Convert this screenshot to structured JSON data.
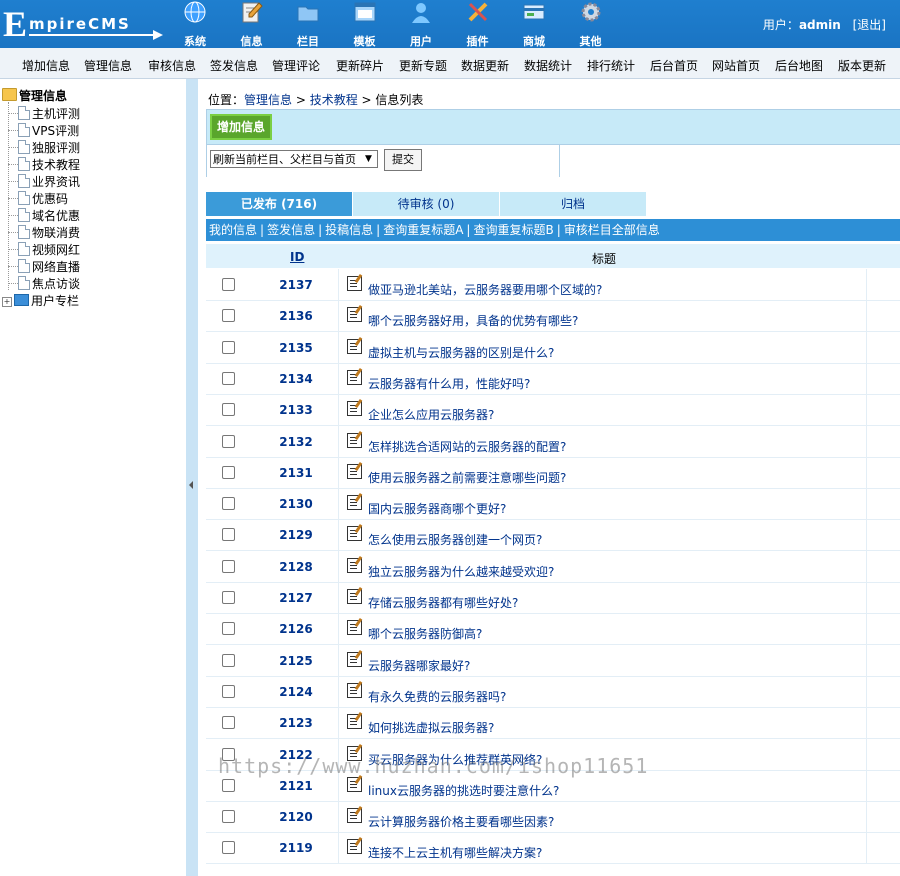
{
  "logo": {
    "initial": "E",
    "rest": "mpireCMS"
  },
  "nav": [
    {
      "label": "系统",
      "icon": "globe-icon",
      "color": "#3ea0ff"
    },
    {
      "label": "信息",
      "icon": "edit-note-icon",
      "color": "#f1f1f1"
    },
    {
      "label": "栏目",
      "icon": "folder-icon",
      "color": "#8fc6f5"
    },
    {
      "label": "模板",
      "icon": "template-window-icon",
      "color": "#a9d6fb"
    },
    {
      "label": "用户",
      "icon": "user-icon",
      "color": "#7ec8ff"
    },
    {
      "label": "插件",
      "icon": "tools-icon",
      "color": "#f4b23a"
    },
    {
      "label": "商城",
      "icon": "shop-card-icon",
      "color": "#d9ecff"
    },
    {
      "label": "其他",
      "icon": "gear-icon",
      "color": "#cfd8e3"
    }
  ],
  "user": {
    "prefix": "用户：",
    "name": "admin",
    "logout": "[退出]"
  },
  "menu": [
    "增加信息",
    "管理信息",
    "审核信息",
    "签发信息",
    "管理评论",
    "更新碎片",
    "更新专题",
    "数据更新",
    "数据统计",
    "排行统计",
    "后台首页",
    "网站首页",
    "后台地图",
    "版本更新"
  ],
  "sidebar": {
    "root": "管理信息",
    "items": [
      "主机评测",
      "VPS评测",
      "独服评测",
      "技术教程",
      "业界资讯",
      "优惠码",
      "域名优惠",
      "物联消费",
      "视频网红",
      "网络直播",
      "焦点访谈"
    ],
    "user_column": "用户专栏"
  },
  "breadcrumb": {
    "prefix": "位置：",
    "link1": "管理信息",
    "sep": " > ",
    "link2": "技术教程",
    "current": "信息列表"
  },
  "actions": {
    "add_button": "增加信息",
    "refresh_select": "刷新当前栏目、父栏目与首页",
    "submit": "提交"
  },
  "tabs": [
    {
      "label": "已发布 (716)",
      "active": true
    },
    {
      "label": "待审核 (0)",
      "active": false
    },
    {
      "label": "归档",
      "active": false
    }
  ],
  "list_links": [
    "我的信息",
    "签发信息",
    "投稿信息",
    "查询重复标题A",
    "查询重复标题B",
    "审核栏目全部信息"
  ],
  "columns": {
    "id": "ID",
    "title": "标题"
  },
  "rows": [
    {
      "id": "2137",
      "title": "做亚马逊北美站，云服务器要用哪个区域的?"
    },
    {
      "id": "2136",
      "title": "哪个云服务器好用，具备的优势有哪些?"
    },
    {
      "id": "2135",
      "title": "虚拟主机与云服务器的区别是什么?"
    },
    {
      "id": "2134",
      "title": "云服务器有什么用，性能好吗?"
    },
    {
      "id": "2133",
      "title": "企业怎么应用云服务器?"
    },
    {
      "id": "2132",
      "title": "怎样挑选合适网站的云服务器的配置?"
    },
    {
      "id": "2131",
      "title": "使用云服务器之前需要注意哪些问题?"
    },
    {
      "id": "2130",
      "title": "国内云服务器商哪个更好?"
    },
    {
      "id": "2129",
      "title": "怎么使用云服务器创建一个网页?"
    },
    {
      "id": "2128",
      "title": "独立云服务器为什么越来越受欢迎?"
    },
    {
      "id": "2127",
      "title": "存储云服务器都有哪些好处?"
    },
    {
      "id": "2126",
      "title": "哪个云服务器防御高?"
    },
    {
      "id": "2125",
      "title": "云服务器哪家最好?"
    },
    {
      "id": "2124",
      "title": "有永久免费的云服务器吗?"
    },
    {
      "id": "2123",
      "title": "如何挑选虚拟云服务器?"
    },
    {
      "id": "2122",
      "title": "买云服务器为什么推荐群英网络?"
    },
    {
      "id": "2121",
      "title": "linux云服务器的挑选时要注意什么?"
    },
    {
      "id": "2120",
      "title": "云计算服务器价格主要看哪些因素?"
    },
    {
      "id": "2119",
      "title": "连接不上云主机有哪些解决方案?"
    }
  ],
  "watermark": "https://www.huzhan.com/ishop11651"
}
